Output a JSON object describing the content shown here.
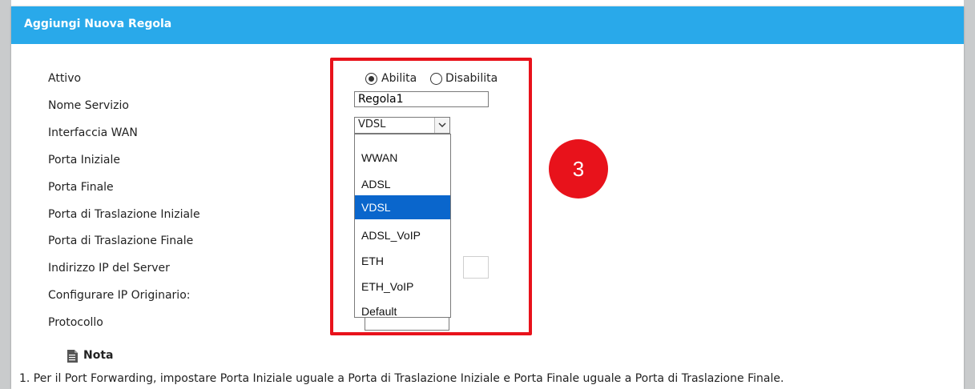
{
  "dialog": {
    "title": "Aggiungi Nuova Regola",
    "header_color": "#29a9ea"
  },
  "form": {
    "labels": {
      "active": "Attivo",
      "service_name": "Nome Servizio",
      "wan_interface": "Interfaccia WAN",
      "start_port": "Porta Iniziale",
      "end_port": "Porta Finale",
      "translation_start_port": "Porta di Traslazione Iniziale",
      "translation_end_port": "Porta di Traslazione Finale",
      "server_ip": "Indirizzo IP del Server",
      "originating_ip": "Configurare IP Originario:",
      "protocol": "Protocollo"
    },
    "active": {
      "enable_label": "Abilita",
      "disable_label": "Disabilita",
      "selected": "Abilita"
    },
    "service_name_value": "Regola1",
    "wan_interface": {
      "selected": "VDSL",
      "options": [
        "WWAN",
        "ADSL",
        "VDSL",
        "ADSL_VoIP",
        "ETH",
        "ETH_VoIP",
        "Default"
      ]
    }
  },
  "annotation": {
    "badge": "3",
    "color": "#e8121b"
  },
  "note": {
    "title": "Nota",
    "line1": "1.  Per il Port Forwarding, impostare Porta Iniziale uguale a Porta di Traslazione Iniziale e Porta Finale uguale a Porta di Traslazione Finale."
  },
  "icons": [
    "note-icon",
    "chevron-down-icon"
  ]
}
